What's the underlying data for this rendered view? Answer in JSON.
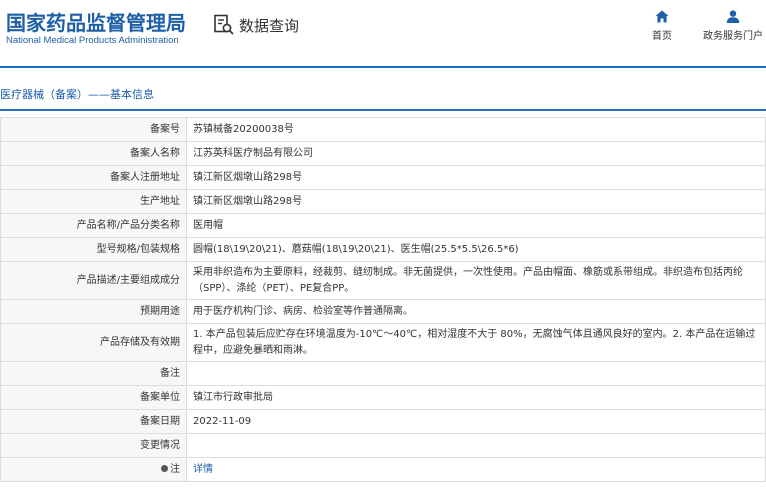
{
  "header": {
    "org_cn": "国家药品监督管理局",
    "org_en": "National Medical Products Administration",
    "query_label": "数据查询",
    "nav": [
      {
        "label": "首页",
        "icon": "home-icon"
      },
      {
        "label": "政务服务门户",
        "icon": "user-icon"
      }
    ]
  },
  "section": {
    "title": "医疗器械（备案）——基本信息"
  },
  "colors": {
    "brand_blue": "#1f5fa8",
    "rule_blue": "#1a6cc4",
    "label_bg": "#f7f7f7",
    "border": "#dcdcdc"
  },
  "rows": [
    {
      "label": "备案号",
      "value": "苏镇械备20200038号"
    },
    {
      "label": "备案人名称",
      "value": "江苏英科医疗制品有限公司"
    },
    {
      "label": "备案人注册地址",
      "value": "镇江新区烟墩山路298号"
    },
    {
      "label": "生产地址",
      "value": "镇江新区烟墩山路298号"
    },
    {
      "label": "产品名称/产品分类名称",
      "value": "医用帽"
    },
    {
      "label": "型号规格/包装规格",
      "value": "圆帽(18\\19\\20\\21)、蘑菇帽(18\\19\\20\\21)、医生帽(25.5*5.5\\26.5*6)"
    },
    {
      "label": "产品描述/主要组成成分",
      "value": "采用非织造布为主要原料，经裁剪、缝纫制成。非无菌提供，一次性使用。产品由帽面、橡筋或系带组成。非织造布包括丙纶（SPP）、涤纶（PET）、PE复合PP。"
    },
    {
      "label": "预期用途",
      "value": "用于医疗机构门诊、病房、检验室等作普通隔离。"
    },
    {
      "label": "产品存储及有效期",
      "value": "1. 本产品包装后应贮存在环境温度为-10℃～40℃，相对湿度不大于 80%，无腐蚀气体且通风良好的室内。2. 本产品在运输过程中，应避免暴晒和雨淋。"
    },
    {
      "label": "备注",
      "value": ""
    },
    {
      "label": "备案单位",
      "value": "镇江市行政审批局"
    },
    {
      "label": "备案日期",
      "value": "2022-11-09"
    },
    {
      "label": "变更情况",
      "value": ""
    },
    {
      "label": "注",
      "value": "详情",
      "icon": "info-dot-icon"
    }
  ]
}
